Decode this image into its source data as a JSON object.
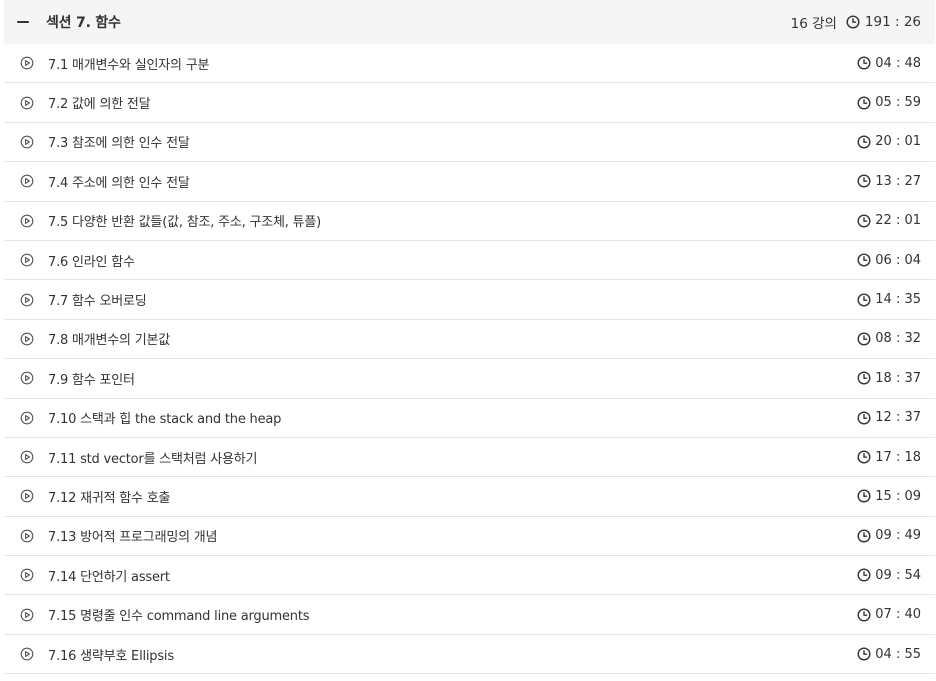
{
  "section": {
    "title": "섹션 7. 함수",
    "lecture_count": "16 강의",
    "total_duration": "191 : 26"
  },
  "lectures": [
    {
      "title": "7.1 매개변수와 실인자의 구분",
      "duration": "04 : 48"
    },
    {
      "title": "7.2 값에 의한 전달",
      "duration": "05 : 59"
    },
    {
      "title": "7.3 참조에 의한 인수 전달",
      "duration": "20 : 01"
    },
    {
      "title": "7.4 주소에 의한 인수 전달",
      "duration": "13 : 27"
    },
    {
      "title": "7.5 다양한 반환 값들(값, 참조, 주소, 구조체, 튜플)",
      "duration": "22 : 01"
    },
    {
      "title": "7.6 인라인 함수",
      "duration": "06 : 04"
    },
    {
      "title": "7.7 함수 오버로딩",
      "duration": "14 : 35"
    },
    {
      "title": "7.8 매개변수의 기본값",
      "duration": "08 : 32"
    },
    {
      "title": "7.9 함수 포인터",
      "duration": "18 : 37"
    },
    {
      "title": "7.10 스택과 힙 the stack and the heap",
      "duration": "12 : 37"
    },
    {
      "title": "7.11 std vector를 스택처럼 사용하기",
      "duration": "17 : 18"
    },
    {
      "title": "7.12 재귀적 함수 호출",
      "duration": "15 : 09"
    },
    {
      "title": "7.13 방어적 프로그래밍의 개념",
      "duration": "09 : 49"
    },
    {
      "title": "7.14 단언하기 assert",
      "duration": "09 : 54"
    },
    {
      "title": "7.15 명령줄 인수 command line arguments",
      "duration": "07 : 40"
    },
    {
      "title": "7.16 생략부호 Ellipsis",
      "duration": "04 : 55"
    }
  ],
  "icons": {
    "collapse": "minus-icon",
    "play": "play-circle-icon",
    "clock": "clock-icon"
  }
}
